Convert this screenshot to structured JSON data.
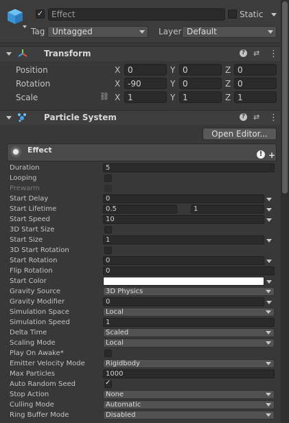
{
  "object": {
    "name": "Effect",
    "static_label": "Static",
    "tag_label": "Tag",
    "tag_value": "Untagged",
    "layer_label": "Layer",
    "layer_value": "Default"
  },
  "transform": {
    "title": "Transform",
    "rows": [
      {
        "label": "Position",
        "x": "0",
        "y": "0",
        "z": "0"
      },
      {
        "label": "Rotation",
        "x": "-90",
        "y": "0",
        "z": "0"
      },
      {
        "label": "Scale",
        "x": "1",
        "y": "1",
        "z": "1"
      }
    ],
    "axis": {
      "x": "X",
      "y": "Y",
      "z": "Z"
    }
  },
  "particle_system": {
    "title": "Particle System",
    "open_editor": "Open Editor...",
    "module_title": "Effect",
    "props": {
      "duration": {
        "label": "Duration",
        "value": "5"
      },
      "looping": {
        "label": "Looping"
      },
      "prewarm": {
        "label": "Prewarm"
      },
      "start_delay": {
        "label": "Start Delay",
        "value": "0"
      },
      "start_lifetime": {
        "label": "Start Lifetime",
        "value_min": "0.5",
        "value_max": "1"
      },
      "start_speed": {
        "label": "Start Speed",
        "value": "10"
      },
      "size_3d": {
        "label": "3D Start Size"
      },
      "start_size": {
        "label": "Start Size",
        "value": "1"
      },
      "rotation_3d": {
        "label": "3D Start Rotation"
      },
      "start_rotation": {
        "label": "Start Rotation",
        "value": "0"
      },
      "flip_rotation": {
        "label": "Flip Rotation",
        "value": "0"
      },
      "start_color": {
        "label": "Start Color",
        "color": "#ffffff"
      },
      "gravity_source": {
        "label": "Gravity Source",
        "value": "3D Physics"
      },
      "gravity_modifier": {
        "label": "Gravity Modifier",
        "value": "0"
      },
      "simulation_space": {
        "label": "Simulation Space",
        "value": "Local"
      },
      "simulation_speed": {
        "label": "Simulation Speed",
        "value": "1"
      },
      "delta_time": {
        "label": "Delta Time",
        "value": "Scaled"
      },
      "scaling_mode": {
        "label": "Scaling Mode",
        "value": "Local"
      },
      "play_on_awake": {
        "label": "Play On Awake*"
      },
      "emitter_velocity_mode": {
        "label": "Emitter Velocity Mode",
        "value": "Rigidbody"
      },
      "max_particles": {
        "label": "Max Particles",
        "value": "1000"
      },
      "auto_random_seed": {
        "label": "Auto Random Seed",
        "check": "✓"
      },
      "stop_action": {
        "label": "Stop Action",
        "value": "None"
      },
      "culling_mode": {
        "label": "Culling Mode",
        "value": "Automatic"
      },
      "ring_buffer_mode": {
        "label": "Ring Buffer Mode",
        "value": "Disabled"
      }
    }
  },
  "icons": {
    "help": "?",
    "presets": "⇄",
    "more": "⋮",
    "warning": "!",
    "plus": "+",
    "check": "✓",
    "link": "⛓"
  },
  "colors": {
    "accent": "#3ea2f0",
    "panel": "#383838",
    "header": "#3e3e3e"
  }
}
